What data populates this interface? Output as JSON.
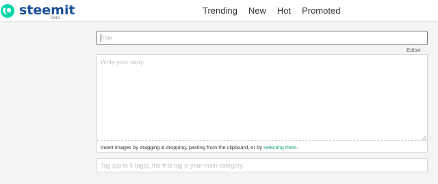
{
  "header": {
    "logo_text": "steemit",
    "logo_badge": "beta",
    "nav": [
      "Trending",
      "New",
      "Hot",
      "Promoted"
    ]
  },
  "editor": {
    "title_placeholder": "Title",
    "editor_toggle": "Editor",
    "story_placeholder": "Write your story...",
    "hint_text": "Insert images by dragging & dropping, pasting from the clipboard, or by ",
    "hint_link": "selecting them",
    "hint_suffix": ".",
    "tags_placeholder": "Tag (up to 5 tags), the first tag is your main category."
  },
  "colors": {
    "brand_teal": "#06d6a9",
    "brand_blue": "#1a5099",
    "link": "#1a9e80"
  }
}
